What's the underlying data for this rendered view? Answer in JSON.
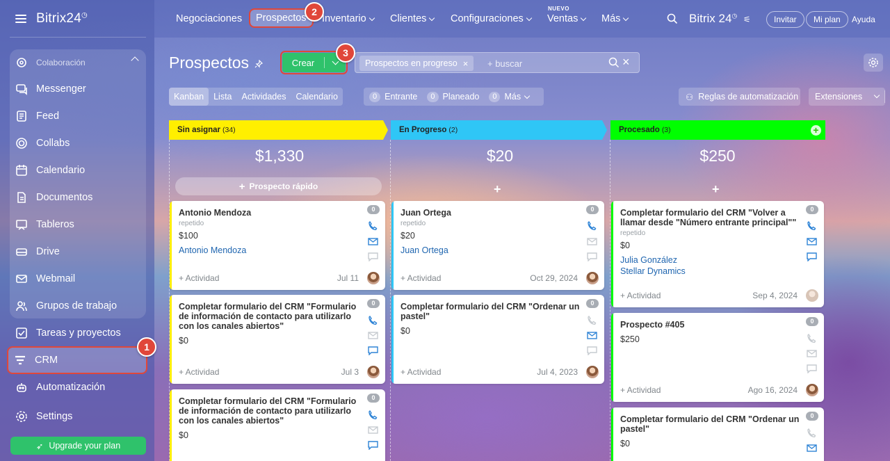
{
  "sidebar": {
    "brand": "Bitrix24",
    "group_title": "Colaboración",
    "items": [
      {
        "label": "Messenger"
      },
      {
        "label": "Feed"
      },
      {
        "label": "Collabs"
      },
      {
        "label": "Calendario"
      },
      {
        "label": "Documentos"
      },
      {
        "label": "Tableros"
      },
      {
        "label": "Drive"
      },
      {
        "label": "Webmail"
      },
      {
        "label": "Grupos de trabajo"
      }
    ],
    "tasks": "Tareas y proyectos",
    "crm": "CRM",
    "automation": "Automatización",
    "settings": "Settings",
    "upgrade": "Upgrade your plan"
  },
  "topbar": {
    "nav": [
      "Negociaciones",
      "Prospectos",
      "Inventario",
      "Clientes",
      "Configuraciones",
      "Ventas",
      "Más"
    ],
    "new_badge": "NUEVO",
    "brand": "Bitrix 24",
    "invite": "Invitar",
    "my_plan": "Mi plan",
    "help": "Ayuda"
  },
  "badges": [
    "1",
    "2",
    "3"
  ],
  "page": {
    "title": "Prospectos",
    "create": "Crear",
    "filter_chip": "Prospectos en progreso",
    "search_placeholder": "+ buscar"
  },
  "views": [
    "Kanban",
    "Lista",
    "Actividades",
    "Calendario"
  ],
  "counters": [
    {
      "count": "0",
      "label": "Entrante"
    },
    {
      "count": "0",
      "label": "Planeado"
    },
    {
      "count": "0",
      "label": "Más"
    }
  ],
  "automation_rules": "Reglas de automatización",
  "extensions": "Extensiones",
  "columns": [
    {
      "name": "Sin asignar",
      "count": "(34)",
      "sum": "$1,330",
      "color": "#ffef00",
      "quick": "Prospecto rápido"
    },
    {
      "name": "En Progreso",
      "count": "(2)",
      "sum": "$20",
      "color": "#2fc6f6"
    },
    {
      "name": "Procesado",
      "count": "(3)",
      "sum": "$250",
      "color": "#00ff00"
    }
  ],
  "cards": [
    {
      "title": "Antonio Mendoza",
      "sub": "repetido",
      "amount": "$100",
      "links": [
        "Antonio Mendoza"
      ],
      "activity": "+ Actividad",
      "date": "Jul 11",
      "count": "0"
    },
    {
      "title": "Completar formulario del CRM \"Formulario de información de contacto para utilizarlo con los canales abiertos\"",
      "amount": "$0",
      "activity": "+ Actividad",
      "date": "Jul 3",
      "count": "0"
    },
    {
      "title": "Completar formulario del CRM \"Formulario de información de contacto para utilizarlo con los canales abiertos\"",
      "amount": "$0",
      "count": "0"
    },
    {
      "title": "Juan Ortega",
      "sub": "repetido",
      "amount": "$20",
      "links": [
        "Juan Ortega"
      ],
      "activity": "+ Actividad",
      "date": "Oct 29, 2024",
      "count": "0"
    },
    {
      "title": "Completar formulario del CRM \"Ordenar un pastel\"",
      "amount": "$0",
      "activity": "+ Actividad",
      "date": "Jul 4, 2023",
      "count": "0"
    },
    {
      "title": "Completar formulario del CRM \"Volver a llamar desde \"Número entrante principal\"\"",
      "sub": "repetido",
      "amount": "$0",
      "links": [
        "Julia González",
        "Stellar Dynamics"
      ],
      "activity": "+ Actividad",
      "date": "Sep 4, 2024",
      "count": "0"
    },
    {
      "title": "Prospecto #405",
      "amount": "$250",
      "activity": "+ Actividad",
      "date": "Ago 16, 2024",
      "count": "0"
    },
    {
      "title": "Completar formulario del CRM \"Ordenar un pastel\"",
      "amount": "$0",
      "count": "0"
    }
  ]
}
